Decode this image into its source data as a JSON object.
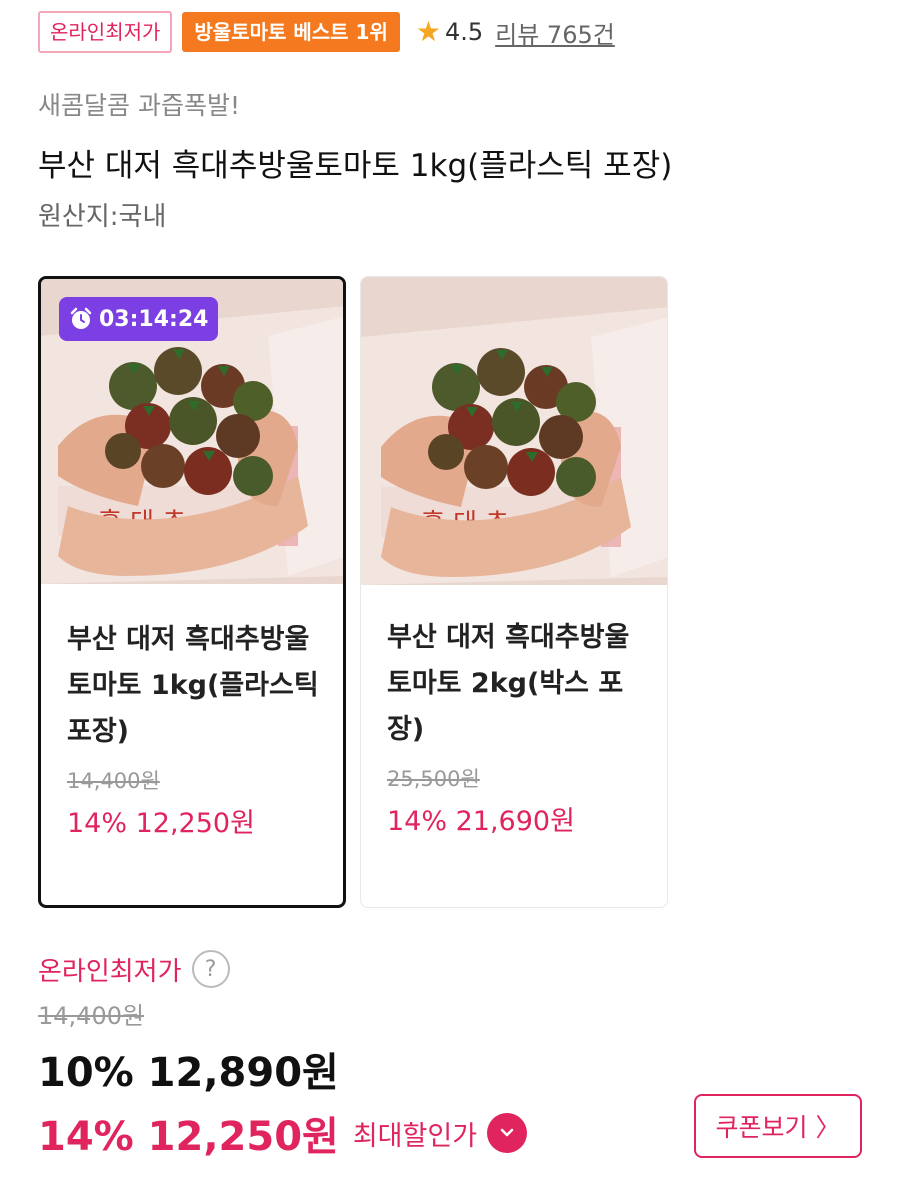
{
  "badges": {
    "lowest_price": "온라인최저가",
    "best": "방울토마토 베스트 1위"
  },
  "rating": {
    "icon": "star-icon",
    "value": "4.5",
    "reviews": "리뷰 765건"
  },
  "product": {
    "subtitle": "새콤달콤 과즙폭발!",
    "title": "부산 대저 흑대추방울토마토 1kg(플라스틱 포장)",
    "origin": "원산지:국내"
  },
  "options": [
    {
      "timer": "03:14:24",
      "name": "부산 대저 흑대추방울토마토 1kg(플라스틱 포장)",
      "original_price": "14,400원",
      "sale_price": "14% 12,250원",
      "selected": true
    },
    {
      "name": "부산 대저 흑대추방울토마토 2kg(박스 포장)",
      "original_price": "25,500원",
      "sale_price": "14% 21,690원",
      "selected": false
    }
  ],
  "pricing": {
    "label": "온라인최저가",
    "help": "?",
    "original": "14,400원",
    "price_1": "10% 12,890원",
    "price_2": "14% 12,250원",
    "max_label": "최대할인가"
  },
  "coupon": {
    "label": "쿠폰보기",
    "arrow": "〉"
  },
  "colors": {
    "accent": "#e0245e",
    "orange": "#f57a1f",
    "timer": "#7b3fe4"
  }
}
